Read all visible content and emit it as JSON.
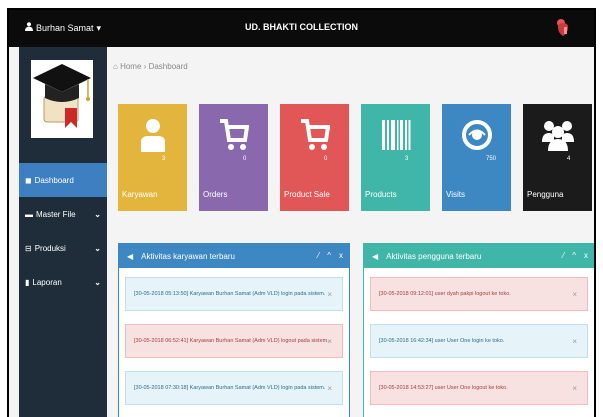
{
  "topbar": {
    "user": "Burhan Samat",
    "user_caret": "▾",
    "brand": "UD. BHAKTI COLLECTION"
  },
  "sidebar": {
    "items": [
      {
        "label": "Dashboard"
      },
      {
        "label": "Master File",
        "chevron": "⌄"
      },
      {
        "label": "Produksi",
        "chevron": "⌄"
      },
      {
        "label": "Laporan",
        "chevron": "⌄"
      }
    ]
  },
  "breadcrumb": {
    "home": "Home",
    "sep": "›",
    "current": "Dashboard"
  },
  "tiles": [
    {
      "label": "Karyawan",
      "count": "3",
      "color": "#e3b53d",
      "icon": "user-icon"
    },
    {
      "label": "Orders",
      "count": "0",
      "color": "#8a68ad",
      "icon": "cart-icon"
    },
    {
      "label": "Product Sale",
      "count": "0",
      "color": "#e15657",
      "icon": "cart-icon"
    },
    {
      "label": "Products",
      "count": "3",
      "color": "#3fb6a7",
      "icon": "barcode-icon"
    },
    {
      "label": "Visits",
      "count": "750",
      "color": "#3d87c3",
      "icon": "eye-icon"
    },
    {
      "label": "Pengguna",
      "count": "4",
      "color": "#1b1b1b",
      "icon": "users-icon"
    }
  ],
  "panels": {
    "left": {
      "title": "Aktivitas karyawan terbaru",
      "head_color": "#3d87c3",
      "tools": [
        "⁄",
        "^",
        "x"
      ],
      "items": [
        {
          "type": "info",
          "text": "[30-05-2018 05:13:50] Karyawan Burhan Samat (Adm VLD) login pada sistem."
        },
        {
          "type": "danger",
          "text": "[30-05-2018 06:52:41] Karyawan Burhan Samat (Adm VLD) logout pada sistem."
        },
        {
          "type": "info",
          "text": "[30-05-2018 07:30:18] Karyawan Burhan Samat (Adm VLD) login pada sistem."
        }
      ]
    },
    "right": {
      "title": "Aktivitas pengguna terbaru",
      "head_color": "#3fb6a7",
      "tools": [
        "⁄",
        "^",
        "x"
      ],
      "items": [
        {
          "type": "danger",
          "text": "[30-05-2018 09:12:01] user dyah pakpi logout ke toko."
        },
        {
          "type": "info",
          "text": "[30-05-2018 16:42:34] user User One login ke toko."
        },
        {
          "type": "danger",
          "text": "[30-05-2018 14:53:27] user User One logout ke toko."
        }
      ]
    }
  },
  "close_glyph": "×"
}
